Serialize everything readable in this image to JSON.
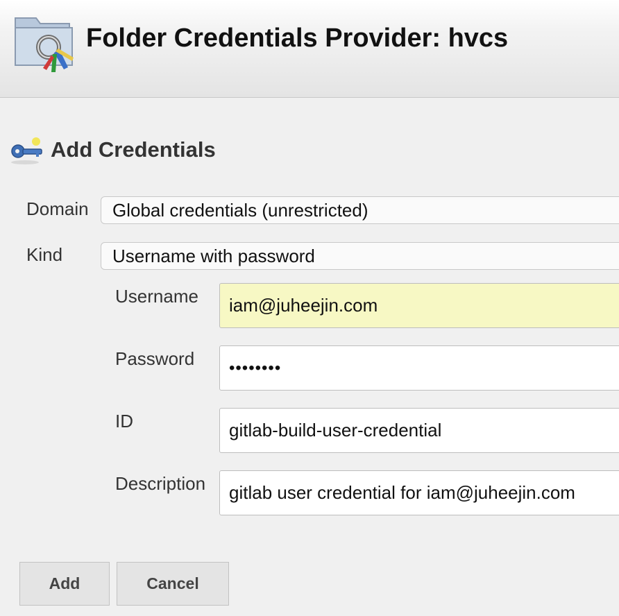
{
  "header": {
    "title": "Folder Credentials Provider: hvcs",
    "icon": "folder-credentials-icon"
  },
  "section": {
    "title": "Add Credentials",
    "icon": "key-icon"
  },
  "form": {
    "domain_label": "Domain",
    "domain_value": "Global credentials (unrestricted)",
    "kind_label": "Kind",
    "kind_value": "Username with password",
    "username_label": "Username",
    "username_value": "iam@juheejin.com",
    "password_label": "Password",
    "password_value": "••••••••",
    "id_label": "ID",
    "id_value": "gitlab-build-user-credential",
    "description_label": "Description",
    "description_value": "gitlab user credential for iam@juheejin.com"
  },
  "buttons": {
    "add_label": "Add",
    "cancel_label": "Cancel"
  },
  "colors": {
    "autofill_background": "#f7f8c4",
    "header_gradient_end": "#e4e4e4",
    "page_background": "#f0f0f0"
  }
}
